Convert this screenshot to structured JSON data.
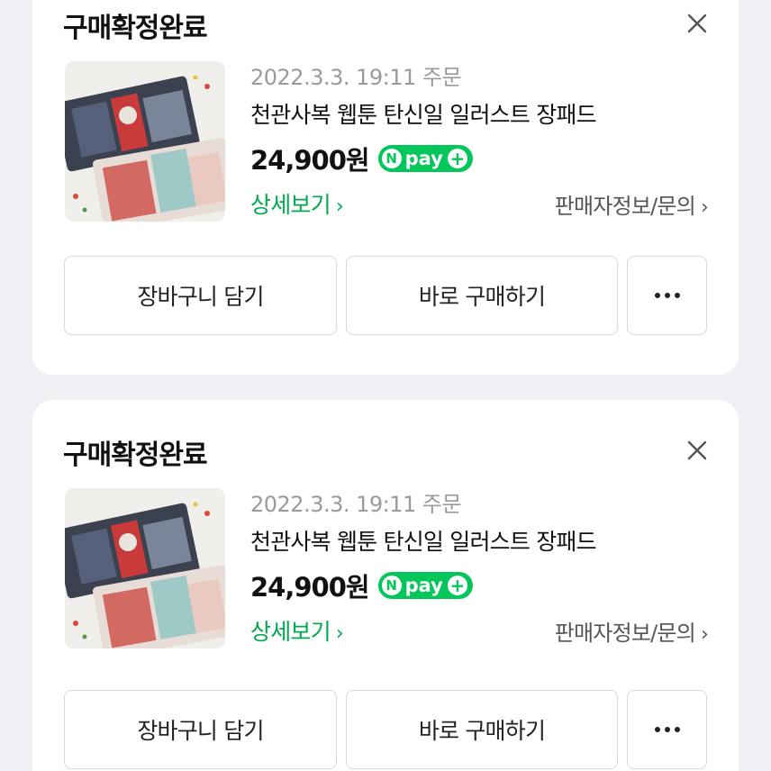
{
  "orders": [
    {
      "status": "구매확정완료",
      "order_date": "2022.3.3. 19:11 주문",
      "product_name": "천관사복 웹툰 탄신일 일러스트 장패드",
      "price": "24,900원",
      "npay_label": "pay",
      "npay_n": "N",
      "detail_link": "상세보기",
      "seller_link": "판매자정보/문의",
      "cart_button": "장바구니 담기",
      "buy_button": "바로 구매하기"
    },
    {
      "status": "구매확정완료",
      "order_date": "2022.3.3. 19:11 주문",
      "product_name": "천관사복 웹툰 탄신일 일러스트 장패드",
      "price": "24,900원",
      "npay_label": "pay",
      "npay_n": "N",
      "detail_link": "상세보기",
      "seller_link": "판매자정보/문의",
      "cart_button": "장바구니 담기",
      "buy_button": "바로 구매하기"
    }
  ],
  "colors": {
    "naver_green": "#03c75a",
    "link_green": "#03a94e",
    "background": "#eef0f3"
  },
  "icons": {
    "close": "close-icon",
    "chevron": "chevron-right-icon",
    "more": "more-dots-icon"
  }
}
